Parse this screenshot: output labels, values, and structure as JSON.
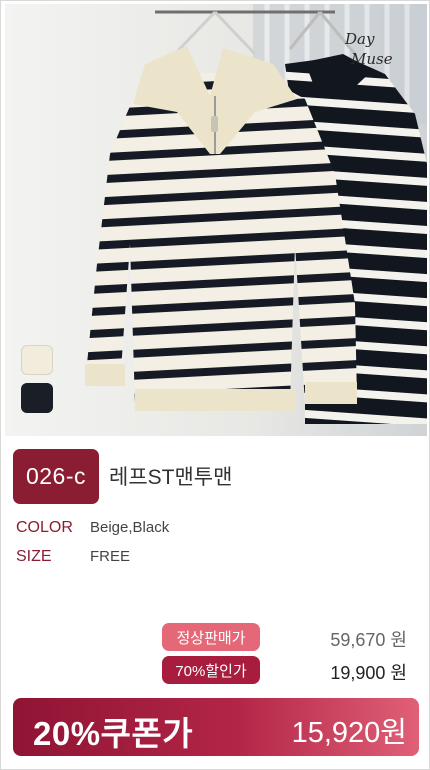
{
  "product": {
    "code": "026-c",
    "name": "레프ST맨투맨",
    "image_watermark": "Day Muse"
  },
  "specs": {
    "color_label": "COLOR",
    "color_value": "Beige,Black",
    "size_label": "SIZE",
    "size_value": "FREE"
  },
  "swatches": [
    {
      "name": "Beige",
      "color": "#f1ecdc"
    },
    {
      "name": "Black",
      "color": "#1a1e26"
    }
  ],
  "pricing": {
    "regular_label": "정상판매가",
    "regular_price": "59,670 원",
    "discount_label": "70%할인가",
    "discount_price": "19,900 원",
    "coupon_label": "20%쿠폰가",
    "coupon_price": "15,920원"
  },
  "colors": {
    "brand": "#8b1d33",
    "tag_regular": "#e46878",
    "tag_discount": "#a81d3e"
  }
}
